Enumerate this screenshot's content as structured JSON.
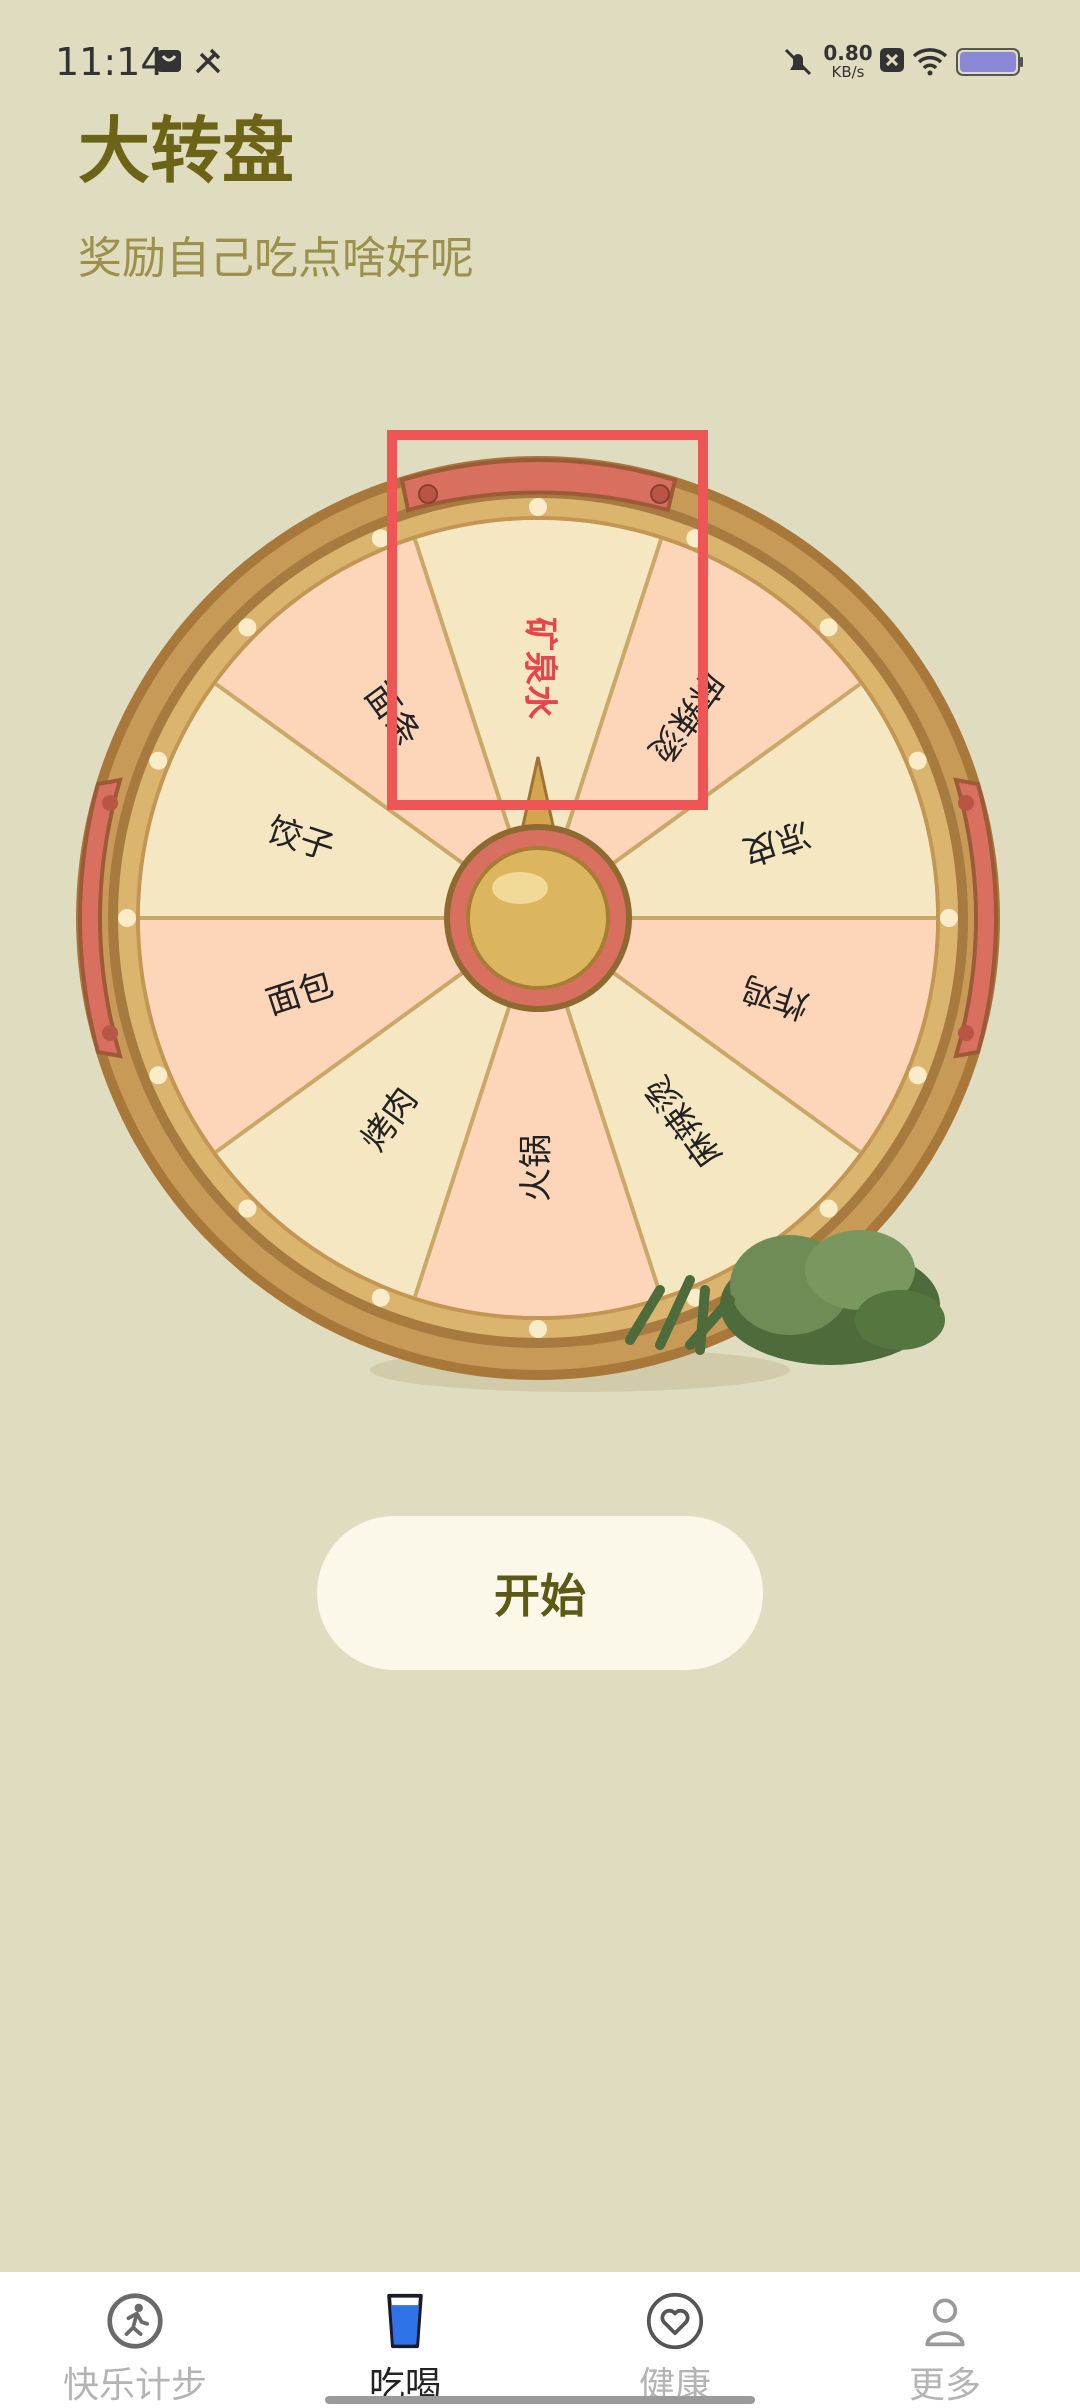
{
  "status_bar": {
    "time": "11:14",
    "net_speed": "0.80",
    "net_unit": "KB/s"
  },
  "header": {
    "title": "大转盘",
    "subtitle": "奖励自己吃点啥好呢"
  },
  "wheel": {
    "segments": [
      {
        "label": "矿泉水",
        "highlighted": true
      },
      {
        "label": "麻辣烫",
        "highlighted": false
      },
      {
        "label": "凉皮",
        "highlighted": false
      },
      {
        "label": "炸鸡",
        "highlighted": false
      },
      {
        "label": "麻辣烫",
        "highlighted": false
      },
      {
        "label": "火锅",
        "highlighted": false
      },
      {
        "label": "烤肉",
        "highlighted": false
      },
      {
        "label": "面包",
        "highlighted": false
      },
      {
        "label": "饺子",
        "highlighted": false
      },
      {
        "label": "面条",
        "highlighted": false
      }
    ],
    "colors": {
      "peach": "#fdd5b9",
      "cream": "#f6e7c3",
      "rim": "#c69a55",
      "highlight_text": "#e8444e",
      "annotation_box": "#ee5555"
    }
  },
  "start_button": {
    "label": "开始"
  },
  "tabbar": {
    "tabs": [
      {
        "label": "快乐计步",
        "icon": "running-person-icon",
        "active": false
      },
      {
        "label": "吃喝",
        "icon": "drink-cup-icon",
        "active": true
      },
      {
        "label": "健康",
        "icon": "heart-icon",
        "active": false
      },
      {
        "label": "更多",
        "icon": "user-icon",
        "active": false
      }
    ]
  }
}
